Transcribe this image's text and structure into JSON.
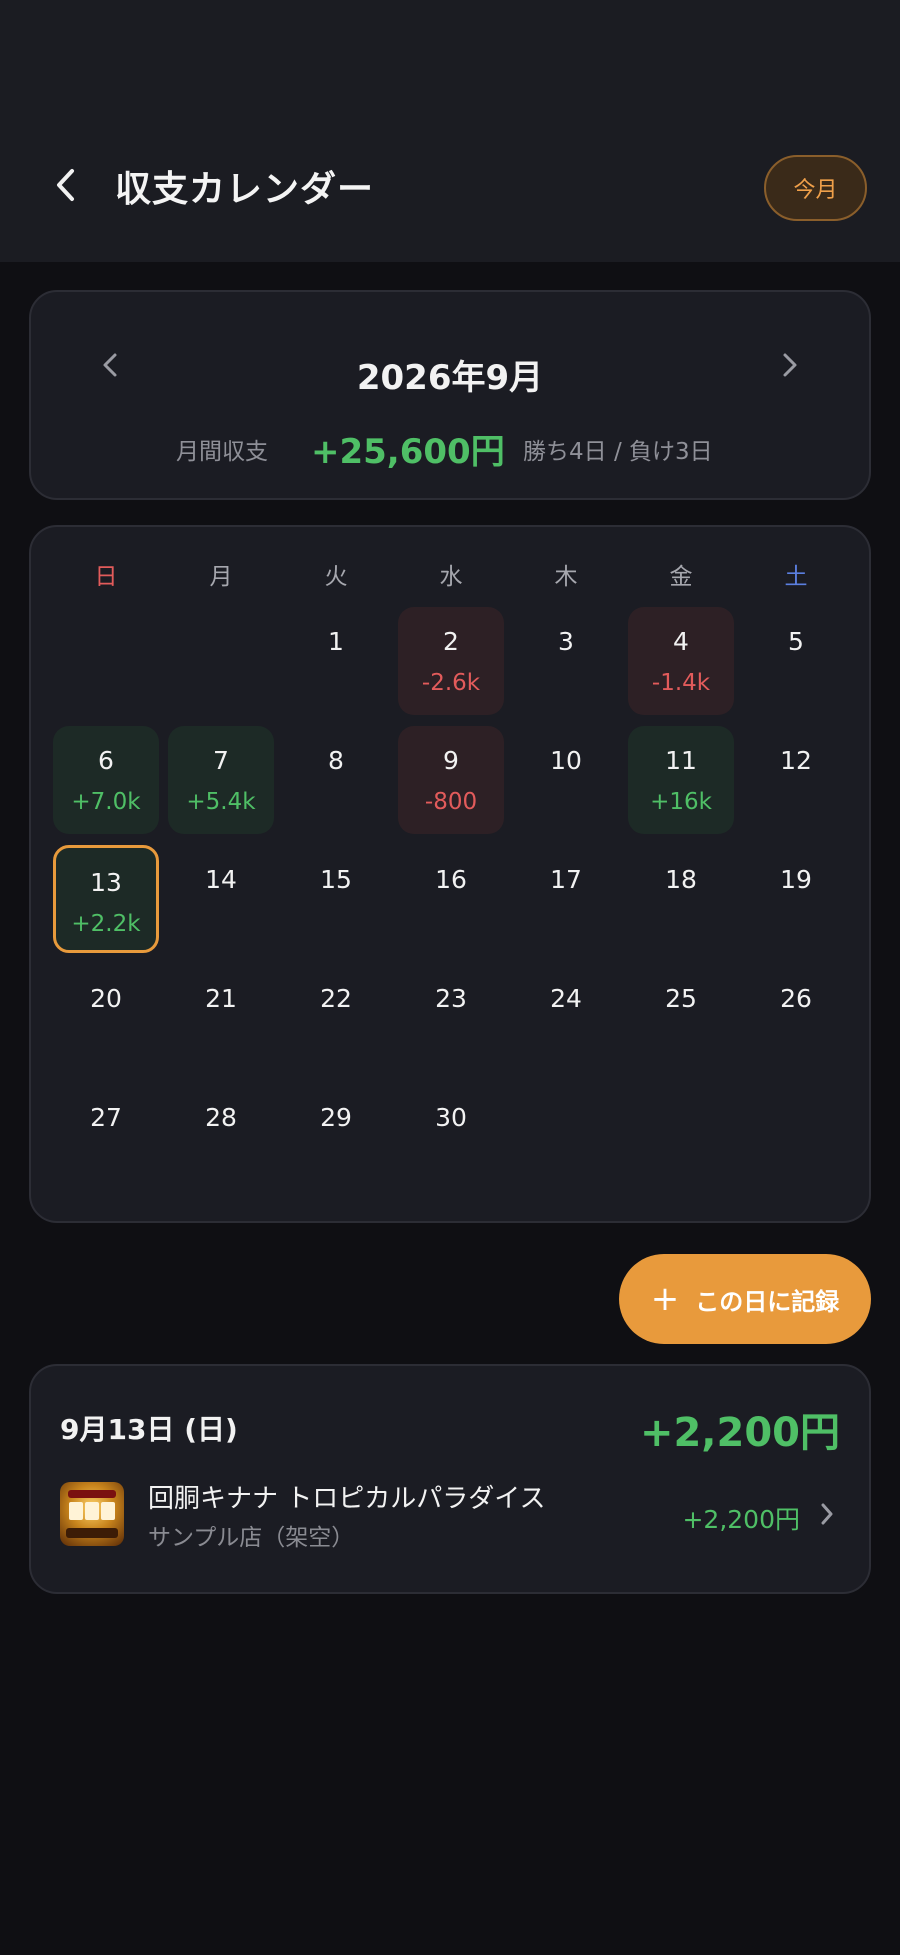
{
  "header": {
    "title": "収支カレンダー",
    "today_label": "今月"
  },
  "month": {
    "label": "2026年9月",
    "summary_label": "月間収支",
    "summary_value": "+25,600円",
    "win_loss": "勝ち4日 / 負け3日"
  },
  "weekdays": [
    "日",
    "月",
    "火",
    "水",
    "木",
    "金",
    "土"
  ],
  "days": [
    {
      "num": "1",
      "amount": "",
      "status": "none"
    },
    {
      "num": "2",
      "amount": "-2.6k",
      "status": "lose"
    },
    {
      "num": "3",
      "amount": "",
      "status": "none"
    },
    {
      "num": "4",
      "amount": "-1.4k",
      "status": "lose"
    },
    {
      "num": "5",
      "amount": "",
      "status": "none"
    },
    {
      "num": "6",
      "amount": "+7.0k",
      "status": "win"
    },
    {
      "num": "7",
      "amount": "+5.4k",
      "status": "win"
    },
    {
      "num": "8",
      "amount": "",
      "status": "none"
    },
    {
      "num": "9",
      "amount": "-800",
      "status": "lose"
    },
    {
      "num": "10",
      "amount": "",
      "status": "none"
    },
    {
      "num": "11",
      "amount": "+16k",
      "status": "win"
    },
    {
      "num": "12",
      "amount": "",
      "status": "none"
    },
    {
      "num": "13",
      "amount": "+2.2k",
      "status": "win",
      "selected": true
    },
    {
      "num": "14",
      "amount": "",
      "status": "none"
    },
    {
      "num": "15",
      "amount": "",
      "status": "none"
    },
    {
      "num": "16",
      "amount": "",
      "status": "none"
    },
    {
      "num": "17",
      "amount": "",
      "status": "none"
    },
    {
      "num": "18",
      "amount": "",
      "status": "none"
    },
    {
      "num": "19",
      "amount": "",
      "status": "none"
    },
    {
      "num": "20",
      "amount": "",
      "status": "none"
    },
    {
      "num": "21",
      "amount": "",
      "status": "none"
    },
    {
      "num": "22",
      "amount": "",
      "status": "none"
    },
    {
      "num": "23",
      "amount": "",
      "status": "none"
    },
    {
      "num": "24",
      "amount": "",
      "status": "none"
    },
    {
      "num": "25",
      "amount": "",
      "status": "none"
    },
    {
      "num": "26",
      "amount": "",
      "status": "none"
    },
    {
      "num": "27",
      "amount": "",
      "status": "none"
    },
    {
      "num": "28",
      "amount": "",
      "status": "none"
    },
    {
      "num": "29",
      "amount": "",
      "status": "none"
    },
    {
      "num": "30",
      "amount": "",
      "status": "none"
    }
  ],
  "add_button": {
    "icon": "plus-icon",
    "label": "この日に記録"
  },
  "detail": {
    "date": "9月13日 (日)",
    "total": "+2,200円",
    "entries": [
      {
        "icon": "slot-machine-icon",
        "machine": "回胴キナナ トロピカルパラダイス",
        "store": "サンプル店（架空）",
        "amount": "+2,200円"
      }
    ]
  },
  "colors": {
    "win": "#4fbf66",
    "lose": "#e25b5b",
    "accent": "#e89a3c",
    "sunday": "#e25b5b",
    "saturday": "#5b7fe0"
  }
}
